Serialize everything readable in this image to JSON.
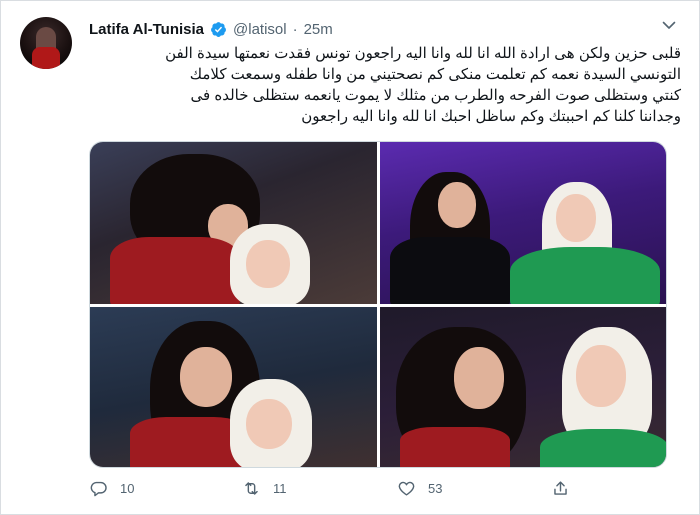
{
  "tweet": {
    "author_name": "Latifa Al-Tunisia",
    "handle": "@latisol",
    "separator": "·",
    "time": "25m",
    "text_lines": [
      "قلبى حزين ولكن هى ارادة الله انا لله وانا اليه راجعون تونس فقدت نعمتها سيدة الفن",
      "التونسي السيدة نعمه كم تعلمت منكى كم نصحتيني من وانا طفله وسمعت كلامك",
      "كنتي وستظلى صوت الفرحه والطرب من مثلك لا يموت يانعمه ستظلى خالده فى",
      "وجداننا كلنا كم احببتك وكم ساظل احبك انا لله وانا اليه راجعون"
    ],
    "actions": {
      "replies": "10",
      "retweets": "11",
      "likes": "53"
    }
  },
  "icons": {
    "verified": "verified-badge-icon",
    "menu": "chevron-down-icon",
    "reply": "reply-icon",
    "retweet": "retweet-icon",
    "like": "heart-icon",
    "share": "share-icon"
  },
  "colors": {
    "verified": "#1d9bf0",
    "secondary_text": "#536471",
    "primary_text": "#0f1419",
    "border": "#cfd9de"
  }
}
